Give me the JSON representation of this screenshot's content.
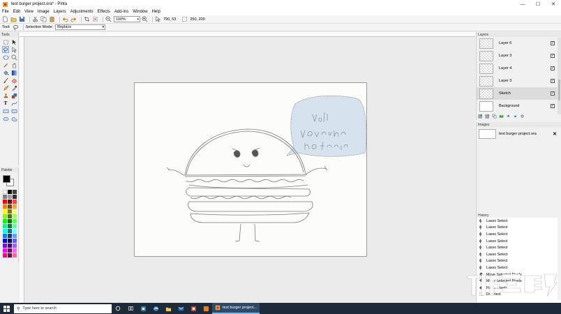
{
  "window": {
    "title": "test burger project.ora* - Pinta",
    "minimize": "—",
    "maximize": "☐",
    "close": "✕"
  },
  "menu": [
    "File",
    "Edit",
    "View",
    "Image",
    "Layers",
    "Adjustments",
    "Effects",
    "Add-ins",
    "Window",
    "Help"
  ],
  "toolbar": {
    "zoom": "100%",
    "cursor_pos": "790, 53",
    "selection_size": "250, 200"
  },
  "tool_options": {
    "tool_label": "Tool:",
    "mode_label": "Selection Mode:",
    "mode_value": "Replace"
  },
  "panels": {
    "tools": "Tools",
    "palette": "Palette",
    "layers": "Layers",
    "images": "Images",
    "history": "History"
  },
  "layers": [
    {
      "name": "Layer 6",
      "visible": true
    },
    {
      "name": "Layer 3",
      "visible": true
    },
    {
      "name": "Layer 4",
      "visible": true
    },
    {
      "name": "Layer 3",
      "visible": true
    },
    {
      "name": "Sketch",
      "visible": true
    },
    {
      "name": "Background",
      "visible": true
    }
  ],
  "images": [
    {
      "name": "test burger project.ora"
    }
  ],
  "history": [
    "Lasso Select",
    "Lasso Select",
    "Lasso Select",
    "Lasso Select",
    "Lasso Select",
    "Lasso Select",
    "Lasso Select",
    "Lasso Select",
    "Move Selected Pixels",
    "Move Selected Pixels",
    "Finish Pixels",
    "Deselect"
  ],
  "taskbar": {
    "search_placeholder": "Type here to search",
    "active_app": "test burger project..."
  },
  "colors": {
    "primary": "#000000",
    "secondary": "#ffffff",
    "taskbar": "#1c2a3a",
    "speech_bubble": "#d6e2ee"
  }
}
